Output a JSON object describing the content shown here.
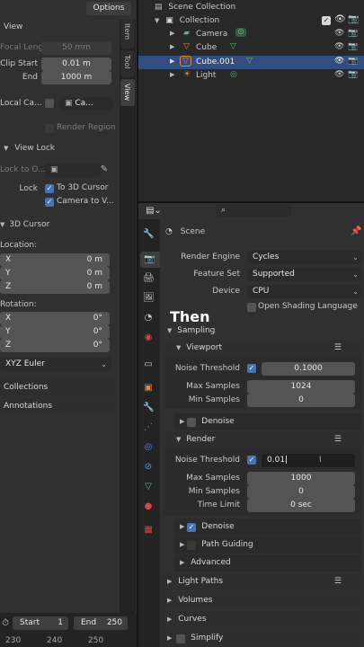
{
  "left": {
    "options_label": "Options",
    "view_header": "View",
    "focal_length_label": "Focal Length",
    "focal_length_value": "50 mm",
    "clip_start_label": "Clip Start",
    "clip_start_value": "0.01 m",
    "end_label": "End",
    "end_value": "1000 m",
    "local_camera_label": "Local Ca...",
    "local_camera_value": "Ca...",
    "render_region_label": "Render Region",
    "view_lock_header": "View Lock",
    "lock_to_object_label": "Lock to O...",
    "lock_label": "Lock",
    "to_3d_cursor_label": "To 3D Cursor",
    "camera_to_view_label": "Camera to V...",
    "cursor_header": "3D Cursor",
    "location_label": "Location:",
    "loc_x": "0 m",
    "loc_y": "0 m",
    "loc_z": "0 m",
    "rotation_label": "Rotation:",
    "rot_x": "0°",
    "rot_y": "0°",
    "rot_z": "0°",
    "x_label": "X",
    "y_label": "Y",
    "z_label": "Z",
    "rotation_mode": "XYZ Euler",
    "collections_header": "Collections",
    "annotations_header": "Annotations",
    "tabs": [
      "Item",
      "Tool",
      "View"
    ]
  },
  "timeline": {
    "start_label": "Start",
    "start_value": "1",
    "end_label": "End",
    "end_value": "250",
    "ruler": [
      "230",
      "240",
      "250"
    ]
  },
  "outliner": {
    "scene_collection": "Scene Collection",
    "collection": "Collection",
    "items": [
      {
        "name": "Camera"
      },
      {
        "name": "Cube"
      },
      {
        "name": "Cube.001"
      },
      {
        "name": "Light"
      }
    ]
  },
  "properties": {
    "search_placeholder": "",
    "scene_label": "Scene",
    "render_engine_label": "Render Engine",
    "render_engine_value": "Cycles",
    "feature_set_label": "Feature Set",
    "feature_set_value": "Supported",
    "device_label": "Device",
    "device_value": "CPU",
    "osl_label": "Open Shading Language",
    "sampling_header": "Sampling",
    "viewport_header": "Viewport",
    "vp_noise_threshold_label": "Noise Threshold",
    "vp_noise_threshold_value": "0.1000",
    "vp_max_samples_label": "Max Samples",
    "vp_max_samples_value": "1024",
    "vp_min_samples_label": "Min Samples",
    "vp_min_samples_value": "0",
    "vp_denoise_label": "Denoise",
    "render_header": "Render",
    "r_noise_threshold_label": "Noise Threshold",
    "r_noise_threshold_value": "0.01",
    "r_max_samples_label": "Max Samples",
    "r_max_samples_value": "1000",
    "r_min_samples_label": "Min Samples",
    "r_min_samples_value": "0",
    "r_time_limit_label": "Time Limit",
    "r_time_limit_value": "0 sec",
    "r_denoise_label": "Denoise",
    "path_guiding_label": "Path Guiding",
    "advanced_label": "Advanced",
    "light_paths_header": "Light Paths",
    "volumes_header": "Volumes",
    "curves_header": "Curves",
    "simplify_header": "Simplify"
  },
  "overlay_caption": "Then",
  "colors": {
    "accent": "#4772b3",
    "outliner_selected": "#334d80",
    "camera_green": "#5fb870",
    "cube_orange": "#e08a3a"
  }
}
